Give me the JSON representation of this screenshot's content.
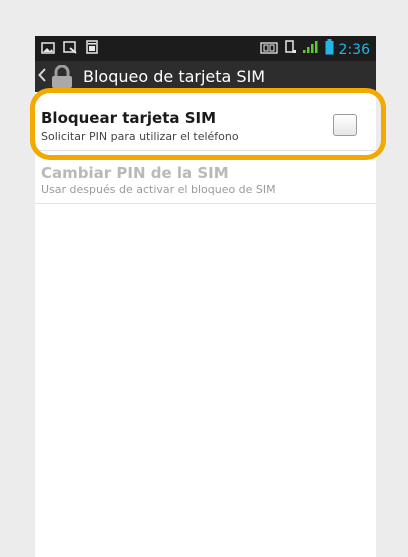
{
  "status_bar": {
    "time": "2:36",
    "icons": [
      "gallery-icon",
      "screenshot-icon",
      "sim-toolkit-icon",
      "nfc-icon",
      "vibrate-icon",
      "signal-icon",
      "battery-icon"
    ]
  },
  "action_bar": {
    "title": "Bloqueo de tarjeta SIM",
    "icons": [
      "back-chevron-icon",
      "lock-icon"
    ]
  },
  "settings": [
    {
      "title": "Bloquear tarjeta SIM",
      "subtitle": "Solicitar PIN para utilizar el teléfono",
      "checked": false,
      "enabled": true
    },
    {
      "title": "Cambiar PIN de la SIM",
      "subtitle": "Usar después de activar el bloqueo de SIM",
      "enabled": false
    }
  ],
  "colors": {
    "highlight": "#f2a900",
    "accent": "#23b6e6",
    "status_bar_bg": "#1c1c1c",
    "action_bar_bg": "#2d2d2d"
  }
}
